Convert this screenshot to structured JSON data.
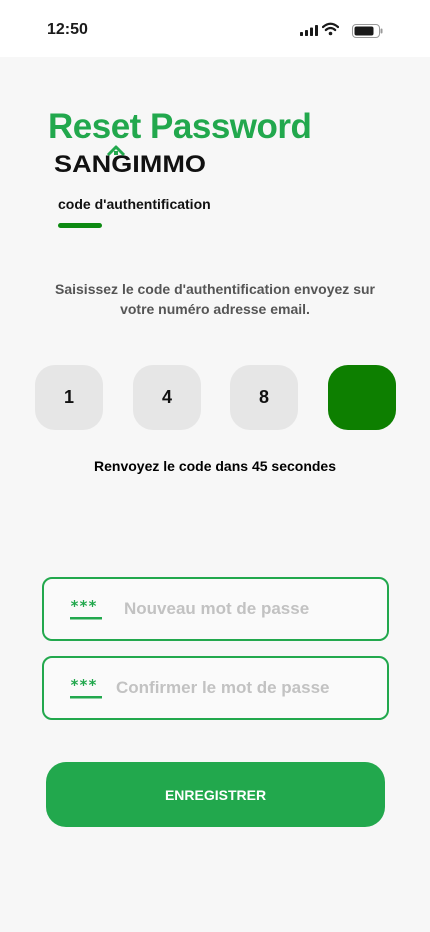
{
  "status_bar": {
    "time": "12:50"
  },
  "header": {
    "title": "Reset Password",
    "brand": "SANGIMMO"
  },
  "tab": {
    "label": "code d'authentification"
  },
  "instructions": "Saisissez le code d'authentification envoyez sur votre numéro adresse email.",
  "otp": {
    "digits": [
      "1",
      "4",
      "8",
      ""
    ]
  },
  "resend": "Renvoyez le code dans 45 secondes",
  "form": {
    "new_password": {
      "placeholder": "Nouveau mot de passe",
      "icon": "password-icon"
    },
    "confirm_password": {
      "placeholder": "Confirmer le mot de passe",
      "icon": "password-icon"
    },
    "save_label": "ENREGISTRER"
  },
  "colors": {
    "accent": "#22a84d",
    "tab_underline": "#0d8a12",
    "otp_active": "#0d7f00",
    "otp_inactive": "#e6e6e6"
  }
}
